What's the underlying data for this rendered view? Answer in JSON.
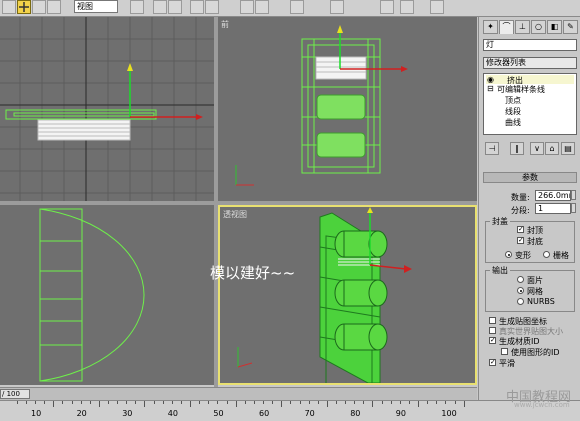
{
  "toolbar": {
    "view_combo": "视图",
    "buttons": [
      "select-icon",
      "move-icon",
      "rotate-icon",
      "scale-icon",
      "magnet-icon",
      "angle-snap-icon",
      "percent-snap-icon",
      "mirror-icon",
      "align-icon",
      "layer-icon",
      "curve-editor-icon",
      "schematic-icon",
      "material-icon",
      "render-setup-icon",
      "render-icon"
    ]
  },
  "viewports": {
    "top_left_label": "",
    "top_right_label": "前",
    "bottom_right_label": "透视图",
    "annotation": "模以建好~~"
  },
  "timeline": {
    "slider_text": "/ 100",
    "ticks": [
      "10",
      "20",
      "30",
      "40",
      "50",
      "60",
      "70",
      "80",
      "90",
      "100"
    ]
  },
  "panel": {
    "tabs": [
      "create-icon",
      "modify-icon",
      "hierarchy-icon",
      "motion-icon",
      "display-icon",
      "utilities-icon"
    ],
    "object_name": "灯",
    "modifier_list": "修改器列表",
    "stack": {
      "item1": "挤出",
      "item2": "可编辑样条线",
      "sub": [
        "顶点",
        "线段",
        "曲线"
      ]
    },
    "params_title": "参数",
    "amount_label": "数量:",
    "amount_value": "266.0mm",
    "segments_label": "分段:",
    "segments_value": "1",
    "capping_title": "封盖",
    "cap_start": "封顶",
    "cap_end": "封底",
    "morph": "变形",
    "grid": "栅格",
    "output_title": "输出",
    "out_patch": "面片",
    "out_mesh": "网格",
    "out_nurbs": "NURBS",
    "gen_map": "生成贴图坐标",
    "real_world": "真实世界贴图大小",
    "gen_mat": "生成材质ID",
    "use_shape": "使用图形的ID",
    "smooth": "平滑"
  },
  "watermark": {
    "big": "中国教程网",
    "small": "www.jcwcn.com"
  },
  "colors": {
    "spline_green": "#6ef04a",
    "viewport_bg": "#6f6f6f",
    "active_border": "#e8e070",
    "selected_green": "#3cb83c"
  }
}
